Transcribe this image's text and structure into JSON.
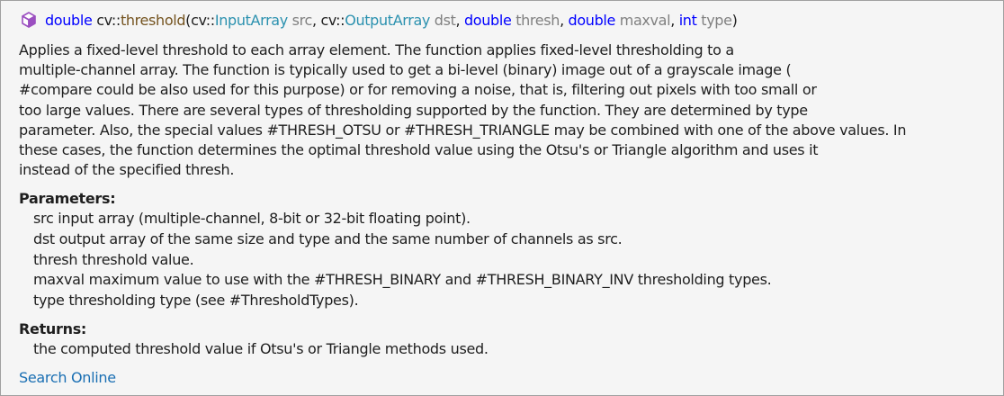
{
  "signature": {
    "return_type": "double",
    "namespace": "cv::",
    "function_name": "threshold",
    "open_paren": "(",
    "params": [
      {
        "ns": "cv::",
        "type": "InputArray",
        "type_is_keyword": false,
        "name": "src",
        "sep": ", "
      },
      {
        "ns": "cv::",
        "type": "OutputArray",
        "type_is_keyword": false,
        "name": "dst",
        "sep": ", "
      },
      {
        "ns": "",
        "type": "double",
        "type_is_keyword": true,
        "name": "thresh",
        "sep": ", "
      },
      {
        "ns": "",
        "type": "double",
        "type_is_keyword": true,
        "name": "maxval",
        "sep": ", "
      },
      {
        "ns": "",
        "type": "int",
        "type_is_keyword": true,
        "name": "type",
        "sep": ""
      }
    ],
    "close_paren": ")"
  },
  "description_lines": [
    "Applies a fixed-level threshold to each array element. The function applies fixed-level thresholding to a",
    "multiple-channel array. The function is typically used to get a bi-level (binary) image out of a grayscale image (",
    "#compare could be also used for this purpose) or for removing a noise, that is, filtering out pixels with too small or",
    "too large values. There are several types of thresholding supported by the function. They are determined by type",
    "parameter. Also, the special values #THRESH_OTSU or #THRESH_TRIANGLE may be combined with one of the above values. In",
    "these cases, the function determines the optimal threshold value using the Otsu's or Triangle algorithm and uses it",
    "instead of the specified thresh."
  ],
  "parameters": {
    "title": "Parameters:",
    "items": [
      "src input array (multiple-channel, 8-bit or 32-bit floating point).",
      "dst output array of the same size and type and the same number of channels as src.",
      "thresh threshold value.",
      "maxval maximum value to use with the #THRESH_BINARY and #THRESH_BINARY_INV thresholding types.",
      "type thresholding type (see #ThresholdTypes)."
    ]
  },
  "returns": {
    "title": "Returns:",
    "text": "the computed threshold value if Otsu's or Triangle methods used."
  },
  "search_link": "Search Online",
  "icon": "method-cube-icon",
  "colors": {
    "keyword": "#0000ff",
    "function": "#74531f",
    "type": "#2b91af",
    "param_name": "#808080",
    "link": "#1a6fb3",
    "icon": "#9b4fc0"
  }
}
